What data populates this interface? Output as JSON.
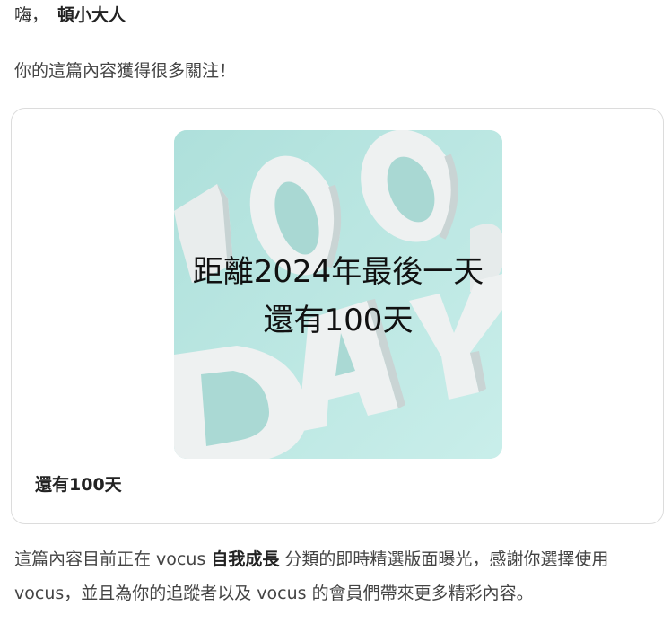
{
  "greeting": {
    "hi": "嗨，",
    "name": "頓小大人"
  },
  "intro": "你的這篇內容獲得很多關注！",
  "card": {
    "cover_line1": "距離2024年最後一天",
    "cover_line2": "還有100天",
    "title": "還有100天"
  },
  "body": {
    "part1": "這篇內容目前正在 vocus ",
    "category": "自我成長",
    "part2": " 分類的即時精選版面曝光，感謝你選擇使用 vocus，並且為你的追蹤者以及 vocus 的會員們帶來更多精彩內容。"
  },
  "colors": {
    "cover_background": "#bfe8e4",
    "card_border": "#dcdcdc"
  }
}
